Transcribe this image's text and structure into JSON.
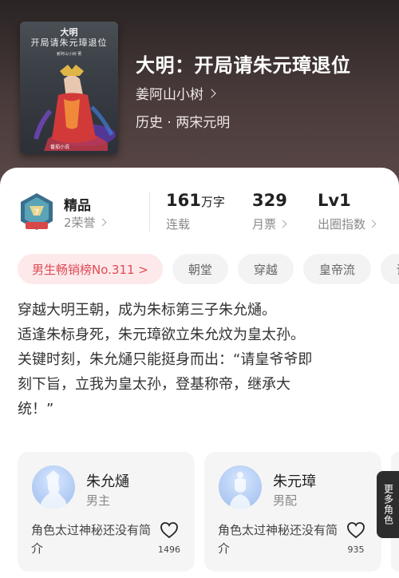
{
  "book": {
    "title": "大明：开局请朱元璋退位",
    "author": "姜阿山小树",
    "genre": "历史 · 两宋元明",
    "cover": {
      "title_line1": "大明",
      "title_line2": "开局请朱元璋退位",
      "author": "姜阿山小树 著",
      "badge": "番茄小说"
    }
  },
  "stats": {
    "quality_label": "精品",
    "honors": "2荣誉",
    "word_count": "161",
    "word_unit": "万字",
    "status": "连载",
    "monthly_tickets": "329",
    "monthly_label": "月票",
    "level": "Lv1",
    "level_label": "出圈指数"
  },
  "tags": {
    "rank": "男生畅销榜No.311 >",
    "items": [
      "朝堂",
      "穿越",
      "皇帝流",
      "谋"
    ]
  },
  "synopsis": [
    "穿越大明王朝，成为朱标第三子朱允熥。",
    "适逢朱标身死，朱元璋欲立朱允炆为皇太孙。",
    "关键时刻，朱允熥只能挺身而出：“请皇爷爷即",
    "刻下旨，立我为皇太孙，登基称帝，继承大",
    "统！”"
  ],
  "roles": [
    {
      "name": "朱允熥",
      "type": "男主",
      "desc": "角色太过神秘还没有简介",
      "likes": "1496"
    },
    {
      "name": "朱元璋",
      "type": "男配",
      "desc": "角色太过神秘还没有简介",
      "likes": "935"
    }
  ],
  "more_roles_label": "更多角色",
  "colors": {
    "header_bg": "#3b3030",
    "rank_tag_bg": "#fde9ea",
    "rank_tag_text": "#e04a55",
    "avatar_blue": "#b4cdf4"
  }
}
